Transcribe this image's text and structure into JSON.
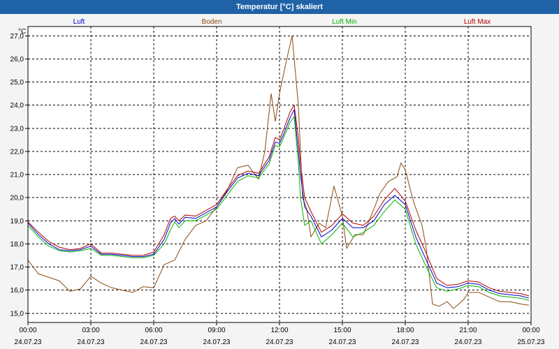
{
  "window": {
    "title": "Temperatur [°C] skaliert"
  },
  "chart_data": {
    "type": "line",
    "title": "Temperatur [°C] skaliert",
    "ylabel": "°C",
    "xlabel": "",
    "ylim": [
      14.6,
      27.4
    ],
    "xlim": [
      0,
      24
    ],
    "y_ticks": [
      15.0,
      16.0,
      17.0,
      18.0,
      19.0,
      20.0,
      21.0,
      22.0,
      23.0,
      24.0,
      25.0,
      26.0,
      27.0
    ],
    "y_tick_labels": [
      "15,0",
      "16,0",
      "17,0",
      "18,0",
      "19,0",
      "20,0",
      "21,0",
      "22,0",
      "23,0",
      "24,0",
      "25,0",
      "26,0",
      "27,0"
    ],
    "x_ticks": [
      {
        "x": 0,
        "time": "00:00",
        "date": "24.07.23"
      },
      {
        "x": 3,
        "time": "03:00",
        "date": "24.07.23"
      },
      {
        "x": 6,
        "time": "06:00",
        "date": "24.07.23"
      },
      {
        "x": 9,
        "time": "09:00",
        "date": "24.07.23"
      },
      {
        "x": 12,
        "time": "12:00",
        "date": "24.07.23"
      },
      {
        "x": 15,
        "time": "15:00",
        "date": "24.07.23"
      },
      {
        "x": 18,
        "time": "18:00",
        "date": "24.07.23"
      },
      {
        "x": 21,
        "time": "21:00",
        "date": "24.07.23"
      },
      {
        "x": 24,
        "time": "00:00",
        "date": "25.07.23"
      }
    ],
    "grid": true,
    "legend_position": "top",
    "series": [
      {
        "name": "Luft",
        "color": "#0000cc",
        "points": [
          [
            0,
            18.9
          ],
          [
            0.5,
            18.4
          ],
          [
            1,
            18.0
          ],
          [
            1.5,
            17.75
          ],
          [
            2,
            17.7
          ],
          [
            2.5,
            17.75
          ],
          [
            3,
            17.9
          ],
          [
            3.5,
            17.55
          ],
          [
            4,
            17.55
          ],
          [
            4.5,
            17.5
          ],
          [
            5,
            17.45
          ],
          [
            5.5,
            17.45
          ],
          [
            6,
            17.55
          ],
          [
            6.5,
            18.2
          ],
          [
            6.8,
            18.9
          ],
          [
            7,
            19.1
          ],
          [
            7.2,
            18.85
          ],
          [
            7.5,
            19.15
          ],
          [
            8,
            19.1
          ],
          [
            8.5,
            19.35
          ],
          [
            9,
            19.6
          ],
          [
            9.5,
            20.25
          ],
          [
            10,
            20.85
          ],
          [
            10.5,
            21.05
          ],
          [
            11,
            20.95
          ],
          [
            11.5,
            21.6
          ],
          [
            11.8,
            22.4
          ],
          [
            12,
            22.35
          ],
          [
            12.2,
            22.75
          ],
          [
            12.5,
            23.45
          ],
          [
            12.7,
            23.8
          ],
          [
            12.9,
            22.0
          ],
          [
            13.0,
            21.0
          ],
          [
            13.2,
            19.6
          ],
          [
            13.5,
            19.2
          ],
          [
            14,
            18.3
          ],
          [
            14.5,
            18.6
          ],
          [
            15,
            19.1
          ],
          [
            15.5,
            18.7
          ],
          [
            16,
            18.7
          ],
          [
            16.5,
            19.0
          ],
          [
            17,
            19.7
          ],
          [
            17.5,
            20.1
          ],
          [
            18,
            19.7
          ],
          [
            18.5,
            18.3
          ],
          [
            19,
            17.3
          ],
          [
            19.5,
            16.3
          ],
          [
            20,
            16.1
          ],
          [
            20.5,
            16.15
          ],
          [
            21,
            16.3
          ],
          [
            21.5,
            16.25
          ],
          [
            22,
            16.0
          ],
          [
            22.5,
            15.85
          ],
          [
            23,
            15.8
          ],
          [
            23.5,
            15.75
          ],
          [
            23.9,
            15.65
          ]
        ]
      },
      {
        "name": "Boden",
        "color": "#8b4a10",
        "points": [
          [
            0,
            17.3
          ],
          [
            0.5,
            16.7
          ],
          [
            1,
            16.55
          ],
          [
            1.5,
            16.4
          ],
          [
            2,
            15.95
          ],
          [
            2.5,
            16.05
          ],
          [
            3,
            16.6
          ],
          [
            3.5,
            16.3
          ],
          [
            4,
            16.1
          ],
          [
            4.5,
            16.0
          ],
          [
            5,
            15.9
          ],
          [
            5.5,
            16.15
          ],
          [
            6,
            16.1
          ],
          [
            6.5,
            17.1
          ],
          [
            7,
            17.3
          ],
          [
            7.5,
            18.2
          ],
          [
            8,
            18.8
          ],
          [
            8.5,
            19.0
          ],
          [
            9,
            19.6
          ],
          [
            9.5,
            20.3
          ],
          [
            10,
            21.3
          ],
          [
            10.5,
            21.4
          ],
          [
            11,
            20.8
          ],
          [
            11.3,
            22.0
          ],
          [
            11.6,
            24.5
          ],
          [
            11.8,
            23.3
          ],
          [
            12,
            24.5
          ],
          [
            12.3,
            25.8
          ],
          [
            12.6,
            27.0
          ],
          [
            12.9,
            24.0
          ],
          [
            13.1,
            20.0
          ],
          [
            13.3,
            19.5
          ],
          [
            13.5,
            18.3
          ],
          [
            13.9,
            18.9
          ],
          [
            14.2,
            18.7
          ],
          [
            14.6,
            20.5
          ],
          [
            15,
            19.2
          ],
          [
            15.2,
            17.8
          ],
          [
            15.6,
            18.4
          ],
          [
            16,
            18.4
          ],
          [
            16.5,
            19.5
          ],
          [
            16.8,
            20.2
          ],
          [
            17.2,
            20.7
          ],
          [
            17.6,
            20.9
          ],
          [
            17.8,
            21.5
          ],
          [
            18,
            21.2
          ],
          [
            18.4,
            19.8
          ],
          [
            18.8,
            18.8
          ],
          [
            19,
            17.8
          ],
          [
            19.3,
            15.4
          ],
          [
            19.6,
            15.3
          ],
          [
            20,
            15.5
          ],
          [
            20.3,
            15.2
          ],
          [
            20.8,
            15.6
          ],
          [
            21,
            15.9
          ],
          [
            21.5,
            15.9
          ],
          [
            22,
            15.7
          ],
          [
            22.5,
            15.5
          ],
          [
            23,
            15.5
          ],
          [
            23.5,
            15.4
          ],
          [
            23.9,
            15.35
          ]
        ]
      },
      {
        "name": "Luft Min",
        "color": "#00b400",
        "points": [
          [
            0,
            18.8
          ],
          [
            0.5,
            18.3
          ],
          [
            1,
            17.9
          ],
          [
            1.5,
            17.7
          ],
          [
            2,
            17.65
          ],
          [
            2.5,
            17.7
          ],
          [
            3,
            17.8
          ],
          [
            3.5,
            17.5
          ],
          [
            4,
            17.5
          ],
          [
            4.5,
            17.45
          ],
          [
            5,
            17.4
          ],
          [
            5.5,
            17.4
          ],
          [
            6,
            17.5
          ],
          [
            6.5,
            18.0
          ],
          [
            6.8,
            18.6
          ],
          [
            7,
            18.95
          ],
          [
            7.2,
            18.7
          ],
          [
            7.5,
            19.0
          ],
          [
            8,
            19.0
          ],
          [
            8.5,
            19.25
          ],
          [
            9,
            19.5
          ],
          [
            9.5,
            20.1
          ],
          [
            10,
            20.7
          ],
          [
            10.5,
            20.95
          ],
          [
            11,
            20.85
          ],
          [
            11.5,
            21.45
          ],
          [
            11.8,
            22.25
          ],
          [
            12,
            22.2
          ],
          [
            12.2,
            22.6
          ],
          [
            12.5,
            23.25
          ],
          [
            12.7,
            23.5
          ],
          [
            12.9,
            21.5
          ],
          [
            13.0,
            20.0
          ],
          [
            13.2,
            18.8
          ],
          [
            13.5,
            19.0
          ],
          [
            14,
            18.0
          ],
          [
            14.5,
            18.4
          ],
          [
            15,
            18.9
          ],
          [
            15.5,
            18.3
          ],
          [
            16,
            18.5
          ],
          [
            16.5,
            18.8
          ],
          [
            17,
            19.4
          ],
          [
            17.5,
            19.9
          ],
          [
            18,
            19.5
          ],
          [
            18.5,
            18.0
          ],
          [
            19,
            17.0
          ],
          [
            19.5,
            16.1
          ],
          [
            20,
            15.95
          ],
          [
            20.5,
            16.05
          ],
          [
            21,
            16.2
          ],
          [
            21.5,
            16.15
          ],
          [
            22,
            15.9
          ],
          [
            22.5,
            15.75
          ],
          [
            23,
            15.7
          ],
          [
            23.5,
            15.65
          ],
          [
            23.9,
            15.55
          ]
        ]
      },
      {
        "name": "Luft Max",
        "color": "#b00000",
        "points": [
          [
            0,
            18.95
          ],
          [
            0.5,
            18.5
          ],
          [
            1,
            18.1
          ],
          [
            1.5,
            17.85
          ],
          [
            2,
            17.75
          ],
          [
            2.5,
            17.8
          ],
          [
            3,
            18.0
          ],
          [
            3.5,
            17.6
          ],
          [
            4,
            17.6
          ],
          [
            4.5,
            17.55
          ],
          [
            5,
            17.5
          ],
          [
            5.5,
            17.5
          ],
          [
            6,
            17.65
          ],
          [
            6.5,
            18.4
          ],
          [
            6.8,
            19.1
          ],
          [
            7,
            19.2
          ],
          [
            7.2,
            19.0
          ],
          [
            7.5,
            19.25
          ],
          [
            8,
            19.2
          ],
          [
            8.5,
            19.45
          ],
          [
            9,
            19.7
          ],
          [
            9.5,
            20.35
          ],
          [
            10,
            20.95
          ],
          [
            10.5,
            21.15
          ],
          [
            11,
            21.05
          ],
          [
            11.5,
            21.75
          ],
          [
            11.8,
            22.6
          ],
          [
            12,
            22.5
          ],
          [
            12.2,
            22.95
          ],
          [
            12.5,
            23.7
          ],
          [
            12.7,
            24.0
          ],
          [
            12.9,
            22.6
          ],
          [
            13.0,
            21.5
          ],
          [
            13.2,
            20.0
          ],
          [
            13.5,
            19.4
          ],
          [
            14,
            18.5
          ],
          [
            14.5,
            18.8
          ],
          [
            15,
            19.3
          ],
          [
            15.5,
            18.9
          ],
          [
            16,
            18.8
          ],
          [
            16.5,
            19.2
          ],
          [
            17,
            19.9
          ],
          [
            17.5,
            20.4
          ],
          [
            18,
            19.85
          ],
          [
            18.5,
            18.6
          ],
          [
            19,
            17.6
          ],
          [
            19.5,
            16.5
          ],
          [
            20,
            16.2
          ],
          [
            20.5,
            16.25
          ],
          [
            21,
            16.4
          ],
          [
            21.5,
            16.35
          ],
          [
            22,
            16.1
          ],
          [
            22.5,
            15.95
          ],
          [
            23,
            15.9
          ],
          [
            23.5,
            15.85
          ],
          [
            23.9,
            15.75
          ]
        ]
      }
    ]
  }
}
